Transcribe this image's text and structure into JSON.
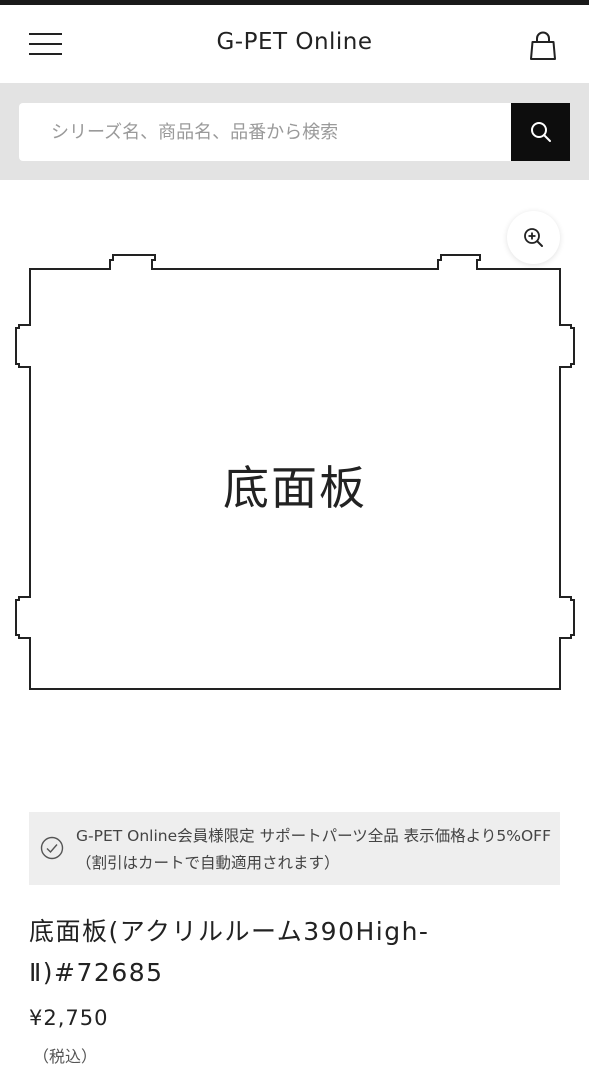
{
  "header": {
    "site_title": "G-PET Online"
  },
  "search": {
    "placeholder": "シリーズ名、商品名、品番から検索"
  },
  "product": {
    "image_label": "底面板",
    "notice": "G-PET Online会員様限定 サポートパーツ全品 表示価格より5%OFF（割引はカートで自動適用されます）",
    "title": "底面板(アクリルルーム390High-Ⅱ)#72685",
    "price": "¥2,750",
    "tax_note": "（税込）"
  },
  "icons": {
    "menu": "hamburger-menu-icon",
    "cart": "shopping-bag-icon",
    "search": "search-icon",
    "zoom": "zoom-in-icon",
    "notice": "check-circle-icon"
  },
  "colors": {
    "search_button": "#0d0d0d",
    "search_band": "#e3e3e3",
    "notice_bg": "#eeeeee"
  }
}
